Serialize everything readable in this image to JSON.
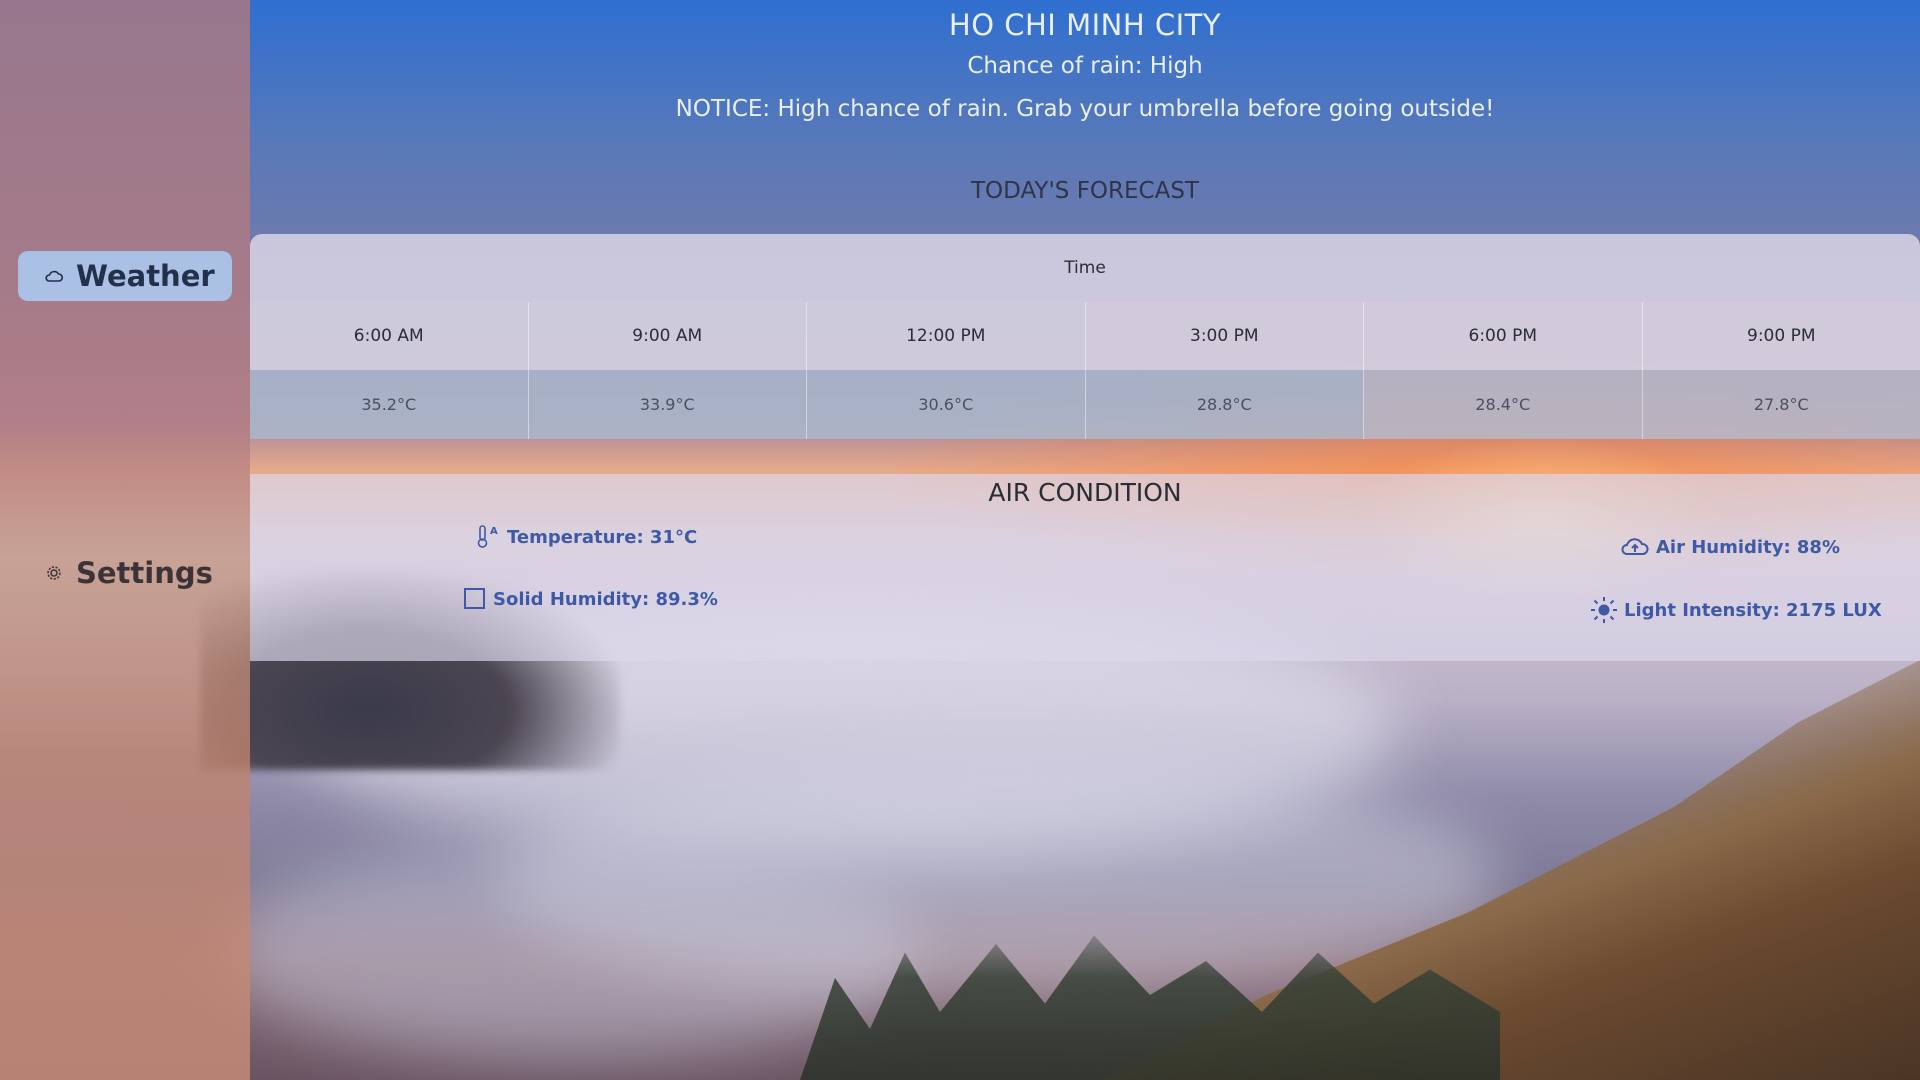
{
  "sidebar": {
    "items": [
      {
        "label": "Weather",
        "icon": "cloud-icon",
        "active": true
      },
      {
        "label": "Settings",
        "icon": "gear-icon",
        "active": false
      }
    ]
  },
  "header": {
    "city": "HO CHI MINH CITY",
    "rain": "Chance of rain: High",
    "notice": "NOTICE: High chance of rain. Grab your umbrella before going outside!"
  },
  "forecast": {
    "title": "TODAY'S FORECAST",
    "time_header": "Time",
    "times": [
      "6:00 AM",
      "9:00 AM",
      "12:00 PM",
      "3:00 PM",
      "6:00 PM",
      "9:00 PM"
    ],
    "temps": [
      "35.2°C",
      "33.9°C",
      "30.6°C",
      "28.8°C",
      "28.4°C",
      "27.8°C"
    ]
  },
  "air": {
    "title": "AIR CONDITION",
    "temperature": "Temperature: 31°C",
    "solid_humidity": "Solid Humidity: 89.3%",
    "air_humidity": "Air Humidity: 88%",
    "light_intensity": "Light Intensity: 2175 LUX"
  },
  "colors": {
    "accent": "#3e5aa6",
    "active_nav": "#aacdf5"
  }
}
